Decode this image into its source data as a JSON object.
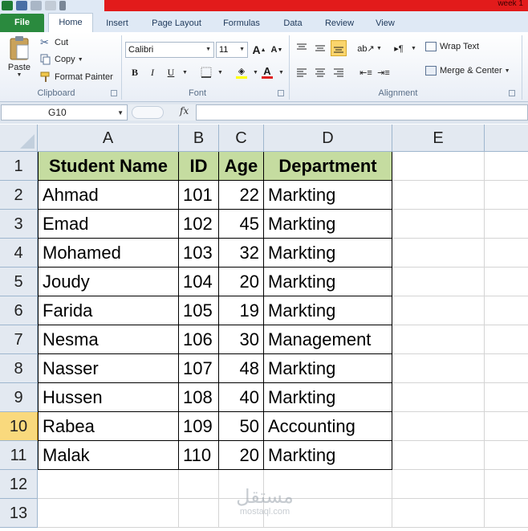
{
  "title": {
    "document": "week 1"
  },
  "tabs": [
    {
      "label": "File"
    },
    {
      "label": "Home"
    },
    {
      "label": "Insert"
    },
    {
      "label": "Page Layout"
    },
    {
      "label": "Formulas"
    },
    {
      "label": "Data"
    },
    {
      "label": "Review"
    },
    {
      "label": "View"
    }
  ],
  "clipboard": {
    "paste_label": "Paste",
    "cut_label": "Cut",
    "copy_label": "Copy",
    "format_painter_label": "Format Painter",
    "group_label": "Clipboard"
  },
  "font": {
    "family": "Calibri",
    "size": "11",
    "group_label": "Font",
    "bold": "B",
    "italic": "I",
    "underline": "U",
    "grow": "A",
    "shrink": "A",
    "font_color_letter": "A",
    "highlight_color": "#ffff00",
    "font_color": "#e02020"
  },
  "alignment": {
    "wrap_text_label": "Wrap Text",
    "merge_center_label": "Merge & Center",
    "group_label": "Alignment"
  },
  "formula_bar": {
    "name_box": "G10",
    "fx": "fx",
    "value": ""
  },
  "grid": {
    "columns": [
      "A",
      "B",
      "C",
      "D",
      "E"
    ],
    "rows": [
      "1",
      "2",
      "3",
      "4",
      "5",
      "6",
      "7",
      "8",
      "9",
      "10",
      "11",
      "12",
      "13"
    ],
    "active_row": "10",
    "header_fill": "#c5dca0",
    "headers": [
      "Student Name",
      "ID",
      "Age",
      "Department"
    ],
    "data": [
      {
        "name": "Ahmad",
        "id": "101",
        "age": "22",
        "dept": "Markting"
      },
      {
        "name": "Emad",
        "id": "102",
        "age": "45",
        "dept": "Markting"
      },
      {
        "name": "Mohamed",
        "id": "103",
        "age": "32",
        "dept": "Markting"
      },
      {
        "name": "Joudy",
        "id": "104",
        "age": "20",
        "dept": "Markting"
      },
      {
        "name": "Farida",
        "id": "105",
        "age": "19",
        "dept": "Markting"
      },
      {
        "name": "Nesma",
        "id": "106",
        "age": "30",
        "dept": "Management"
      },
      {
        "name": "Nasser",
        "id": "107",
        "age": "48",
        "dept": "Markting"
      },
      {
        "name": "Hussen",
        "id": "108",
        "age": "40",
        "dept": "Markting"
      },
      {
        "name": "Rabea",
        "id": "109",
        "age": "50",
        "dept": "Accounting"
      },
      {
        "name": "Malak",
        "id": "110",
        "age": "20",
        "dept": "Markting"
      }
    ]
  },
  "watermark": {
    "arabic": "مستقل",
    "latin": "mostaql.com"
  }
}
